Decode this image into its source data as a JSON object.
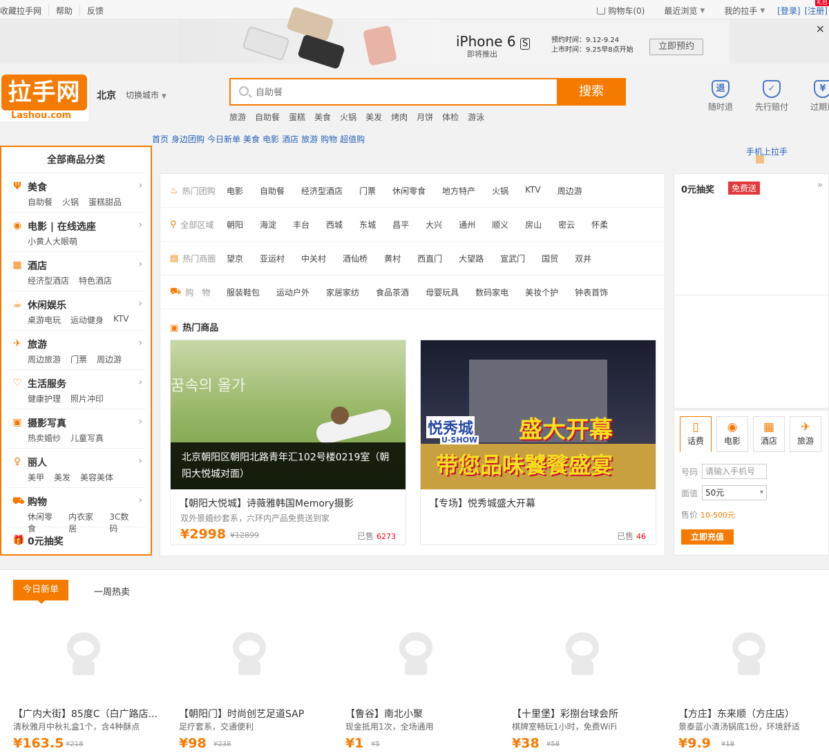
{
  "topbar": {
    "left": [
      "收藏拉手网",
      "帮助",
      "反馈"
    ],
    "cart": "购物车(0)",
    "recent": "最近浏览",
    "mine": "我的拉手",
    "login": "[登录]",
    "register": "[注册]",
    "badge": "礼包"
  },
  "banner": {
    "product": "iPhone 6",
    "product_s": "S",
    "coming": "即将推出",
    "reserve_time": "预约时间：9.12-9.24",
    "launch_time": "上市时间：9.25早8点开始",
    "reserve_btn": "立即预约",
    "close": "×"
  },
  "header": {
    "logo_cn": "拉手网",
    "logo_en": "Lashou.com",
    "city": "北京",
    "switch_city": "切换城市",
    "search_placeholder": "自助餐",
    "search_btn": "搜索",
    "hotwords": [
      "旅游",
      "自助餐",
      "蛋糕",
      "美食",
      "火锅",
      "美发",
      "烤肉",
      "月饼",
      "体检",
      "游泳"
    ],
    "assure": [
      {
        "icon": "退",
        "label": "随时退"
      },
      {
        "icon": "✓",
        "label": "先行赔付"
      },
      {
        "icon": "¥",
        "label": "过期退"
      }
    ],
    "subnav": [
      "首页",
      "身边团购",
      "今日新单",
      "美食",
      "电影",
      "酒店",
      "旅游",
      "购物",
      "超值购"
    ],
    "mobile": "手机上拉手"
  },
  "categories": {
    "title": "全部商品分类",
    "items": [
      {
        "icon": "Ψ",
        "label": "美食",
        "subs": [
          "自助餐",
          "火锅",
          "蛋糕甜品"
        ]
      },
      {
        "icon": "◉",
        "label": "电影 | 在线选座",
        "subs": [
          "小黄人大眼萌"
        ]
      },
      {
        "icon": "▦",
        "label": "酒店",
        "subs": [
          "经济型酒店",
          "特色酒店"
        ]
      },
      {
        "icon": "☕",
        "label": "休闲娱乐",
        "subs": [
          "桌游电玩",
          "运动健身",
          "KTV"
        ]
      },
      {
        "icon": "✈",
        "label": "旅游",
        "subs": [
          "周边旅游",
          "门票",
          "周边游"
        ]
      },
      {
        "icon": "♡",
        "label": "生活服务",
        "subs": [
          "健康护理",
          "照片冲印"
        ]
      },
      {
        "icon": "▣",
        "label": "摄影写真",
        "subs": [
          "热卖婚纱",
          "儿童写真"
        ]
      },
      {
        "icon": "♀",
        "label": "丽人",
        "subs": [
          "美甲",
          "美发",
          "美容美体"
        ]
      },
      {
        "icon": "⛟",
        "label": "购物",
        "subs": [
          "休闲零食",
          "内衣家居",
          "3C数码"
        ]
      },
      {
        "icon": "🎁",
        "label": "0元抽奖",
        "subs": []
      }
    ]
  },
  "filters": [
    {
      "icon": "♨",
      "label": "热门团购",
      "items": [
        "电影",
        "自助餐",
        "经济型酒店",
        "门票",
        "休闲零食",
        "地方特产",
        "火锅",
        "KTV",
        "周边游"
      ]
    },
    {
      "icon": "⚲",
      "label": "全部区域",
      "items": [
        "朝阳",
        "海淀",
        "丰台",
        "西城",
        "东城",
        "昌平",
        "大兴",
        "通州",
        "顺义",
        "房山",
        "密云",
        "怀柔"
      ]
    },
    {
      "icon": "▤",
      "label": "热门商圈",
      "items": [
        "望京",
        "亚运村",
        "中关村",
        "酒仙桥",
        "黄村",
        "西直门",
        "大望路",
        "宣武门",
        "国贸",
        "双井"
      ]
    },
    {
      "icon": "⛟",
      "label": "购　物",
      "items": [
        "服装鞋包",
        "运动户外",
        "家居家纺",
        "食品茶酒",
        "母婴玩具",
        "数码家电",
        "美妆个护",
        "钟表首饰"
      ]
    }
  ],
  "hot": {
    "title": "热门商品",
    "deals": [
      {
        "caption": "北京朝阳区朝阳北路青年汇102号楼0219室（朝阳大悦城对面）",
        "name": "【朝阳大悦城】诗薇雅韩国Memory摄影",
        "desc": "双外景婚纱套系，六环内产品免费送到家",
        "price": "¥2998",
        "orig": "¥12899",
        "sold_label": "已售",
        "sold": "6273",
        "img_text": "꿈속의 올가"
      },
      {
        "caption": "",
        "name": "【专场】悦秀城盛大开幕",
        "desc": "",
        "price": "",
        "orig": "",
        "sold_label": "已售",
        "sold": "46",
        "img_text1": "悦秀城",
        "img_text2": "U-SHOW",
        "img_text3": "盛大开幕",
        "img_text4": "带您品味饕餮盛宴"
      }
    ]
  },
  "lottery": {
    "title": "0元抽奖",
    "badge": "免费送",
    "more": "»"
  },
  "recharge": {
    "tabs": [
      {
        "icon": "▯",
        "label": "话费"
      },
      {
        "icon": "◉",
        "label": "电影"
      },
      {
        "icon": "▦",
        "label": "酒店"
      },
      {
        "icon": "✈",
        "label": "旅游"
      }
    ],
    "phone_label": "号码",
    "phone_placeholder": "请输入手机号",
    "value_label": "面值",
    "value": "50元",
    "price_label": "售价",
    "price": "10-500元",
    "button": "立即充值"
  },
  "bottom": {
    "tab_active": "今日新单",
    "tab_other": "一周热卖",
    "items": [
      {
        "name": "【广内大街】85度C（白广路店...",
        "desc": "清秋雅月中秋礼盒1个，含4种酥点",
        "price": "¥163.5",
        "orig": "¥218"
      },
      {
        "name": "【朝阳门】时尚创艺足道SAP",
        "desc": "足疗套系，交通便利",
        "price": "¥98",
        "orig": "¥238"
      },
      {
        "name": "【鲁谷】南北小聚",
        "desc": "现金抵用1次，全场通用",
        "price": "¥1",
        "orig": "¥5"
      },
      {
        "name": "【十里堡】彩捌台球会所",
        "desc": "棋牌室畅玩1小时，免费WiFi",
        "price": "¥38",
        "orig": "¥58"
      },
      {
        "name": "【方庄】东来顺（方庄店）",
        "desc": "景泰蓝小清汤锅底1份，环境舒适",
        "price": "¥9.9",
        "orig": "¥18"
      }
    ]
  }
}
